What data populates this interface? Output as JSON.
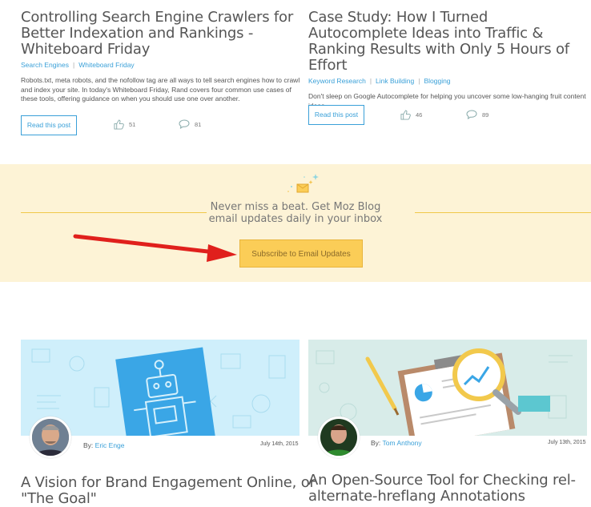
{
  "posts_top": [
    {
      "title": "Controlling Search Engine Crawlers for Better Indexation and Rankings - Whiteboard Friday",
      "categories": [
        "Search Engines",
        "Whiteboard Friday"
      ],
      "excerpt": "Robots.txt, meta robots, and the nofollow tag are all ways to tell search engines how to crawl and index your site. In today's Whiteboard Friday, Rand covers four common use cases of these tools, offering guidance on when you should use one over another.",
      "read_label": "Read this post",
      "likes": "51",
      "comments": "81"
    },
    {
      "title": "Case Study: How I Turned Autocomplete Ideas into Traffic & Ranking Results with Only 5 Hours of Effort",
      "categories": [
        "Keyword Research",
        "Link Building",
        "Blogging"
      ],
      "excerpt": "Don't sleep on Google Autocomplete for helping you uncover some low-hanging fruit content ideas.",
      "read_label": "Read this post",
      "likes": "46",
      "comments": "89"
    }
  ],
  "banner": {
    "line1": "Never miss a beat. Get Moz Blog",
    "line2": "email updates daily in your inbox",
    "button_label": "Subscribe to Email Updates"
  },
  "posts_bottom": [
    {
      "by_label": "By:",
      "author": "Eric Enge",
      "date": "July 14th, 2015",
      "title_line1": "A Vision for Brand Engagement Online, or",
      "title_line2": "\"The Goal\""
    },
    {
      "by_label": "By:",
      "author": "Tom Anthony",
      "date": "July 13th, 2015",
      "title_line1": "An Open-Source Tool for Checking rel-",
      "title_line2": "alternate-hreflang Annotations"
    }
  ],
  "colors": {
    "accent": "#3aa0d8",
    "banner_bg": "#fdf3d6",
    "subscribe_bg": "#fbcd57",
    "arrow": "#e0201c"
  }
}
